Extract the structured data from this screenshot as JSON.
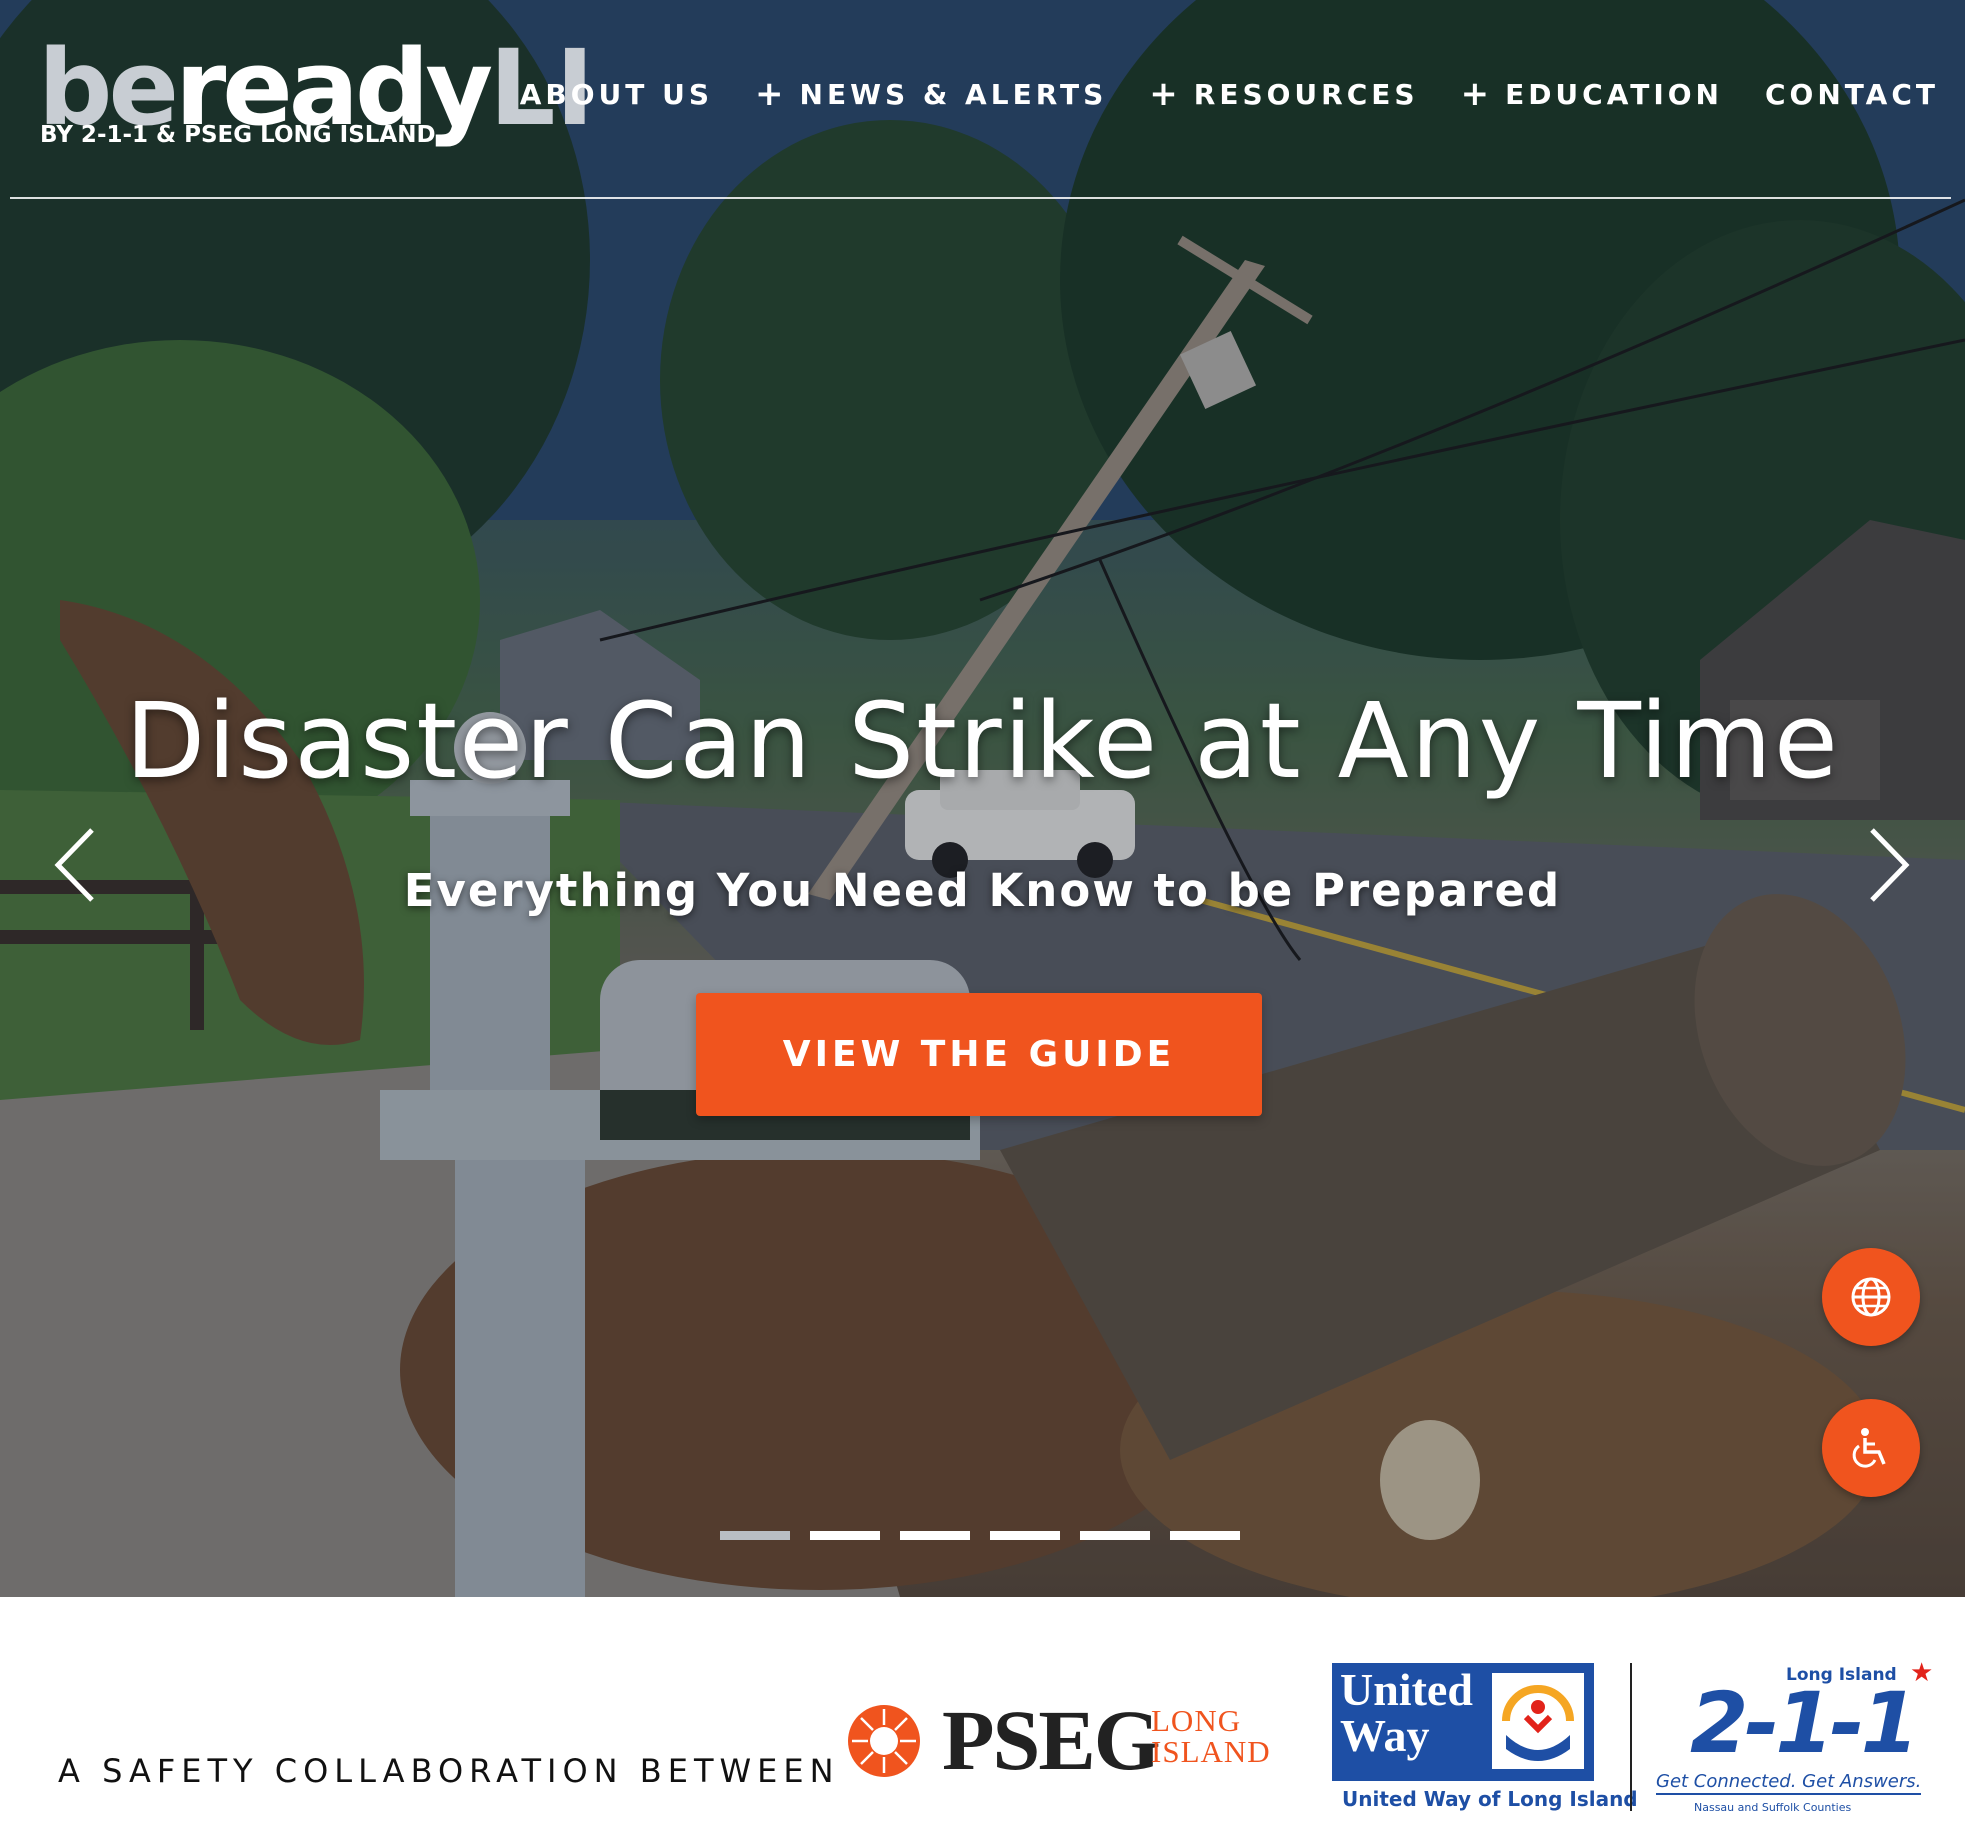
{
  "brand": {
    "logo_be": "be",
    "logo_ready": "ready",
    "logo_li": "LI",
    "tagline": "BY 2-1-1 & PSEG LONG ISLAND"
  },
  "nav": {
    "items": [
      {
        "label": "ABOUT US",
        "expandable": false
      },
      {
        "label": "NEWS & ALERTS",
        "expandable": true
      },
      {
        "label": "RESOURCES",
        "expandable": true
      },
      {
        "label": "EDUCATION",
        "expandable": true
      },
      {
        "label": "CONTACT",
        "expandable": false
      }
    ],
    "expand_glyph": "+"
  },
  "hero": {
    "headline": "Disaster Can Strike at Any Time",
    "subheadline": "Everything You Need Know to be Prepared",
    "cta_label": "VIEW THE GUIDE",
    "slide_count": 6,
    "active_slide": 1,
    "prev_icon": "chevron-left-icon",
    "next_icon": "chevron-right-icon"
  },
  "floating_actions": {
    "language_icon": "globe-icon",
    "accessibility_icon": "wheelchair-icon"
  },
  "partners": {
    "intro": "A SAFETY COLLABORATION BETWEEN",
    "pseg": {
      "name": "PSEG",
      "line1": "LONG",
      "line2": "ISLAND"
    },
    "united_way": {
      "line1": "United",
      "line2": "Way",
      "caption": "United Way of Long Island"
    },
    "two11": {
      "region": "Long Island",
      "number": "2-1-1",
      "tagline": "Get Connected. Get Answers.",
      "counties": "Nassau and Suffolk Counties"
    }
  },
  "colors": {
    "accent": "#f0541e",
    "partner_blue": "#1e4fa5",
    "logo_gray": "#c8cdd3"
  }
}
